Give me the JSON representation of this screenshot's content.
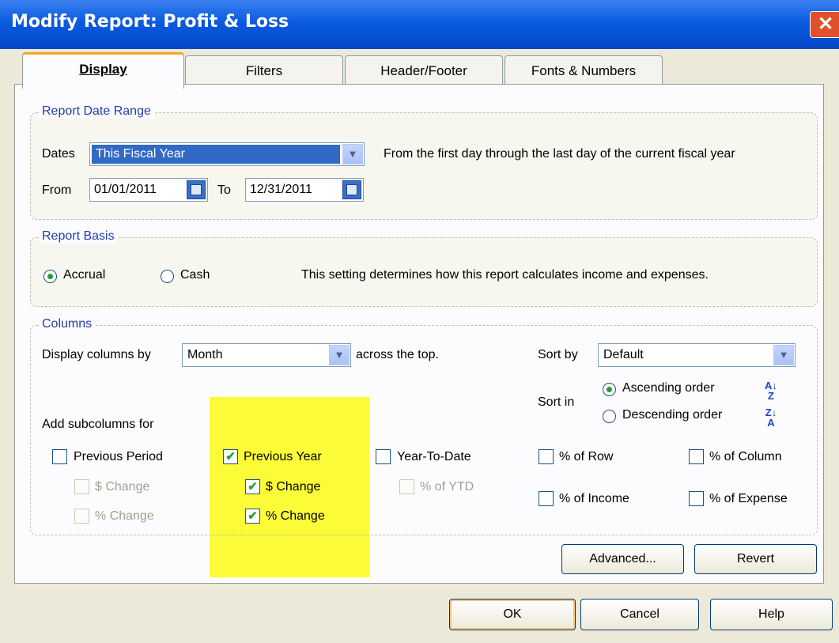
{
  "window": {
    "title": "Modify Report: Profit & Loss",
    "close_glyph": "✕"
  },
  "tabs": [
    {
      "label": "Display",
      "active": true
    },
    {
      "label": "Filters"
    },
    {
      "label": "Header/Footer"
    },
    {
      "label": "Fonts & Numbers"
    }
  ],
  "date_range": {
    "group_label": "Report Date Range",
    "dates_label": "Dates",
    "dates_value": "This Fiscal Year",
    "description": "From the first day through the last day of the current fiscal year",
    "from_label": "From",
    "from_value": "01/01/2011",
    "to_label": "To",
    "to_value": "12/31/2011"
  },
  "basis": {
    "group_label": "Report Basis",
    "accrual_label": "Accrual",
    "cash_label": "Cash",
    "selected": "Accrual",
    "description": "This setting determines how this report calculates income and expenses."
  },
  "columns": {
    "group_label": "Columns",
    "display_by_label": "Display columns by",
    "display_by_value": "Month",
    "across_label": "across the top.",
    "sort_by_label": "Sort by",
    "sort_by_value": "Default",
    "sort_in_label": "Sort in",
    "ascending_label": "Ascending order",
    "descending_label": "Descending order",
    "sort_selected": "Ascending order",
    "add_subcolumns_label": "Add subcolumns for",
    "previous_period": "Previous Period",
    "pp_dollar_change": "$ Change",
    "pp_percent_change": "% Change",
    "previous_year": "Previous Year",
    "py_dollar_change": "$ Change",
    "py_percent_change": "% Change",
    "year_to_date": "Year-To-Date",
    "percent_of_ytd": "% of YTD",
    "percent_of_row": "% of Row",
    "percent_of_column": "% of Column",
    "percent_of_income": "% of Income",
    "percent_of_expense": "% of Expense",
    "checked": [
      "Previous Year",
      "$ Change",
      "% Change"
    ],
    "check_glyph": "✔"
  },
  "buttons": {
    "advanced": "Advanced...",
    "revert": "Revert",
    "ok": "OK",
    "cancel": "Cancel",
    "help": "Help"
  },
  "colors": {
    "highlight": "#fbfb38",
    "group_label": "#2340a8",
    "title_bar": "#0a5be0"
  }
}
